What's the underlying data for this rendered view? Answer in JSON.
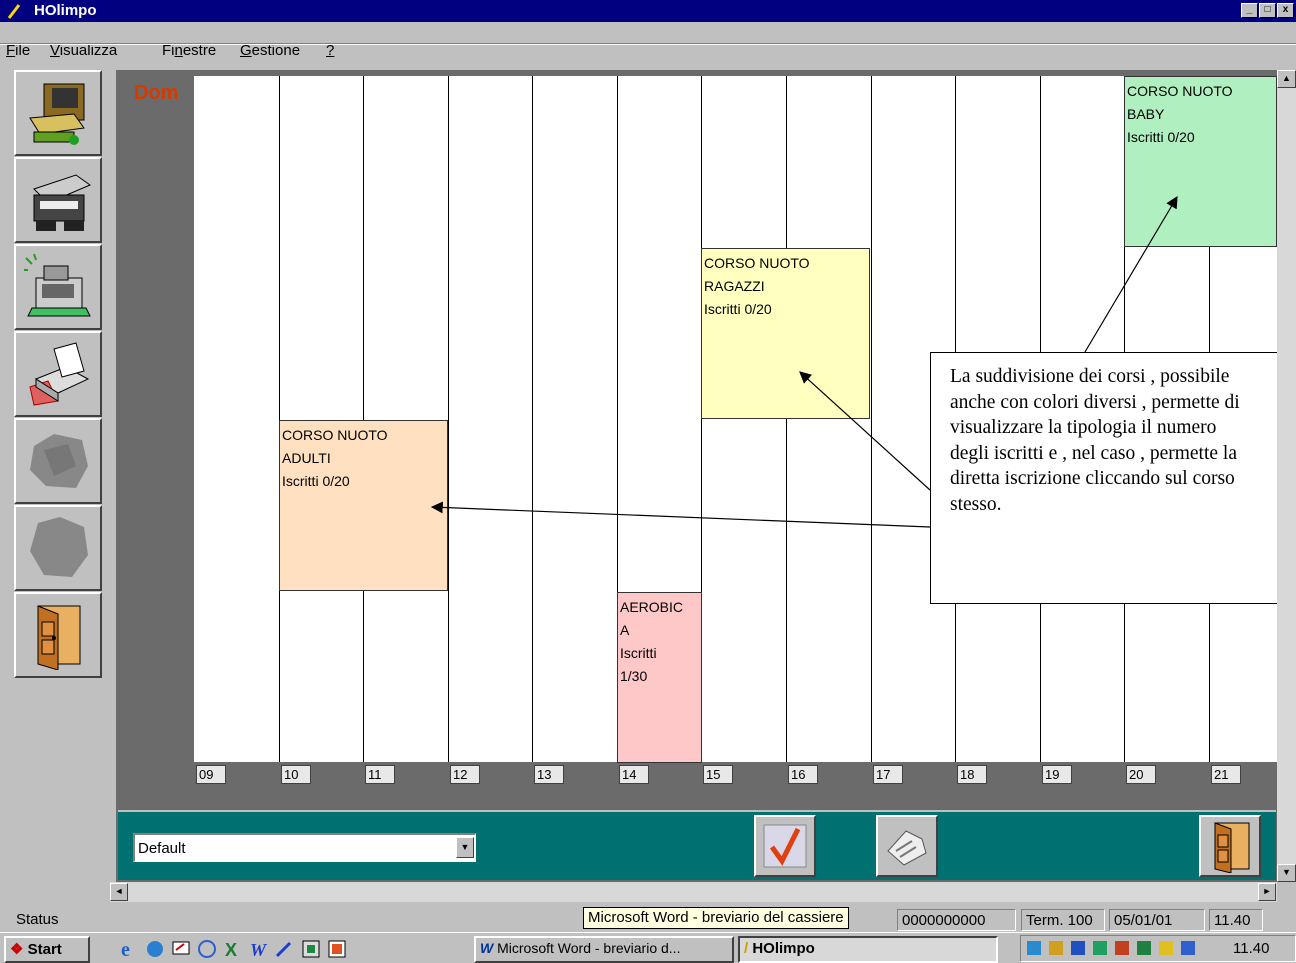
{
  "window": {
    "title": "HOlimpo"
  },
  "menu": [
    {
      "label": "File",
      "underline": "F"
    },
    {
      "label": "Visualizza",
      "underline": "V"
    },
    {
      "label": "Finestre",
      "underline": "n"
    },
    {
      "label": "Gestione",
      "underline": "G"
    },
    {
      "label": "?",
      "underline": "?"
    }
  ],
  "toolbar": [
    {
      "icon": "cash-register-icon",
      "enabled": true
    },
    {
      "icon": "printer-machine-icon",
      "enabled": true
    },
    {
      "icon": "register-ringing-icon",
      "enabled": true
    },
    {
      "icon": "printer-icon",
      "enabled": true
    },
    {
      "icon": "disabled-tool-icon",
      "enabled": false
    },
    {
      "icon": "disabled-tool-icon",
      "enabled": false
    },
    {
      "icon": "exit-door-icon",
      "enabled": true
    }
  ],
  "schedule": {
    "day": "Dom",
    "hours": [
      "09",
      "10",
      "11",
      "12",
      "13",
      "14",
      "15",
      "16",
      "17",
      "18",
      "19",
      "20",
      "21"
    ],
    "courses": [
      {
        "name_line1": "CORSO NUOTO",
        "name_line2": "BABY",
        "enrolled": "Iscritti 0/20",
        "color": "#b0f0c0"
      },
      {
        "name_line1": "CORSO NUOTO",
        "name_line2": "RAGAZZI",
        "enrolled": "Iscritti 0/20",
        "color": "#ffffc0"
      },
      {
        "name_line1": "CORSO NUOTO",
        "name_line2": "ADULTI",
        "enrolled": "Iscritti 0/20",
        "color": "#ffe0c0"
      },
      {
        "name_line1": "AEROBIC",
        "name_line2": "A",
        "enrolled": "Iscritti",
        "enrolled2": "1/30",
        "color": "#ffc8c8"
      }
    ]
  },
  "callout": {
    "lines": [
      "La suddivisione dei corsi , possibile",
      "anche con colori diversi , permette di",
      "visualizzare la tipologia il numero",
      "degli iscritti e , nel caso , permette la",
      "diretta iscrizione cliccando sul corso",
      "stesso."
    ]
  },
  "panel": {
    "select_value": "Default",
    "buttons": [
      "confirm-check-icon",
      "hands-icon",
      "exit-door-icon"
    ]
  },
  "statusbar": {
    "status": "Status",
    "code": "0000000000",
    "terminal": "Term. 100",
    "date": "05/01/01",
    "time": "11.40",
    "tooltip": "Microsoft Word - breviario del cassiere"
  },
  "taskbar": {
    "start": "Start",
    "tasks": [
      "Microsoft Word - breviario d...",
      "HOlimpo"
    ],
    "clock": "11.40"
  }
}
